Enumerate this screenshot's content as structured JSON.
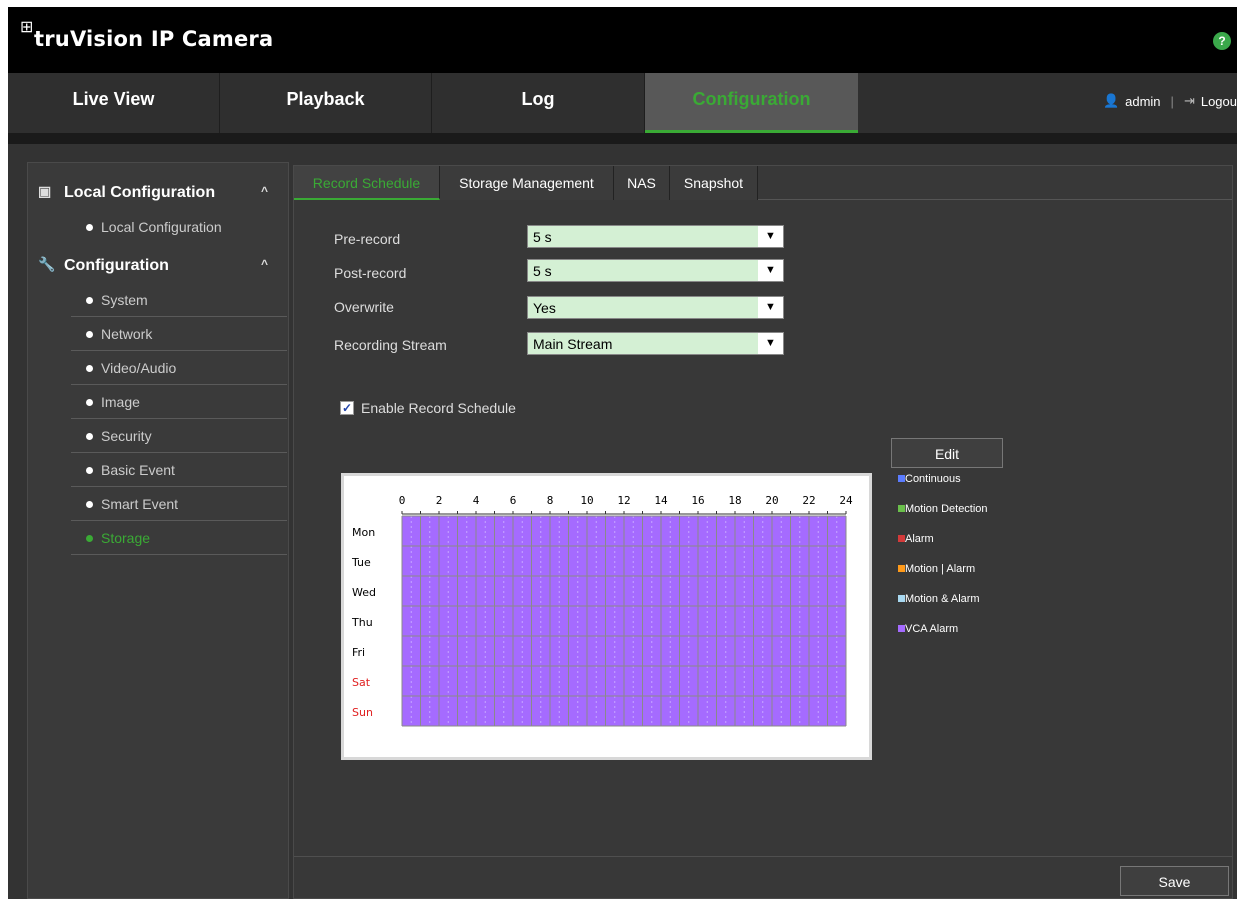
{
  "app": {
    "brand_text": "truVision IP Camera",
    "brand_icon": "camera-logo-icon",
    "help_label": "?"
  },
  "nav": {
    "tabs": [
      {
        "label": "Live View"
      },
      {
        "label": "Playback"
      },
      {
        "label": "Log"
      },
      {
        "label": "Configuration",
        "active": true
      }
    ],
    "user": "admin",
    "separator": "|",
    "logout": "Logou"
  },
  "sidebar": {
    "groups": [
      {
        "label": "Local Configuration",
        "icon": "local-config-icon",
        "caret": "^",
        "items": [
          {
            "label": "Local Configuration"
          }
        ]
      },
      {
        "label": "Configuration",
        "icon": "wrench-icon",
        "caret": "^",
        "items": [
          {
            "label": "System"
          },
          {
            "label": "Network"
          },
          {
            "label": "Video/Audio"
          },
          {
            "label": "Image"
          },
          {
            "label": "Security"
          },
          {
            "label": "Basic Event"
          },
          {
            "label": "Smart Event"
          },
          {
            "label": "Storage",
            "active": true
          }
        ]
      }
    ]
  },
  "tabs": [
    {
      "label": "Record Schedule",
      "active": true
    },
    {
      "label": "Storage Management"
    },
    {
      "label": "NAS"
    },
    {
      "label": "Snapshot"
    }
  ],
  "form": {
    "pre_record": {
      "label": "Pre-record",
      "value": "5 s"
    },
    "post_record": {
      "label": "Post-record",
      "value": "5 s"
    },
    "overwrite": {
      "label": "Overwrite",
      "value": "Yes"
    },
    "recording_stream": {
      "label": "Recording Stream",
      "value": "Main Stream"
    },
    "enable_schedule": {
      "label": "Enable Record Schedule",
      "checked": true
    }
  },
  "schedule": {
    "hours": [
      "0",
      "2",
      "4",
      "6",
      "8",
      "10",
      "12",
      "14",
      "16",
      "18",
      "20",
      "22",
      "24"
    ],
    "days": [
      {
        "label": "Mon",
        "weekend": false
      },
      {
        "label": "Tue",
        "weekend": false
      },
      {
        "label": "Wed",
        "weekend": false
      },
      {
        "label": "Thu",
        "weekend": false
      },
      {
        "label": "Fri",
        "weekend": false
      },
      {
        "label": "Sat",
        "weekend": true
      },
      {
        "label": "Sun",
        "weekend": true
      }
    ],
    "fill_type": "VCA Alarm",
    "fill_color": "#a56bff"
  },
  "edit_label": "Edit",
  "legend": [
    {
      "label": "Continuous",
      "color": "#5b7cff"
    },
    {
      "label": "Motion Detection",
      "color": "#6abf4b"
    },
    {
      "label": "Alarm",
      "color": "#d33a3a"
    },
    {
      "label": "Motion | Alarm",
      "color": "#ff9a1a"
    },
    {
      "label": "Motion & Alarm",
      "color": "#a8d8f0"
    },
    {
      "label": "VCA Alarm",
      "color": "#a56bff"
    }
  ],
  "save_label": "Save",
  "colors": {
    "accent": "#3aaa35",
    "weekend_label": "#e02020"
  }
}
